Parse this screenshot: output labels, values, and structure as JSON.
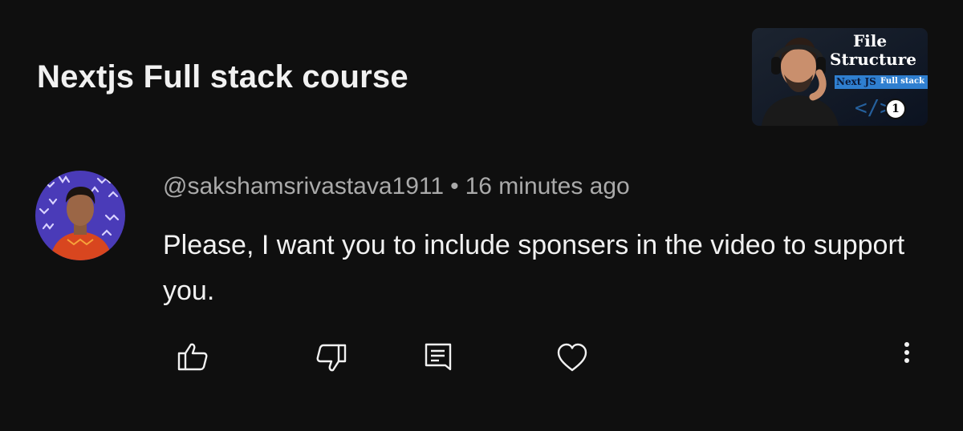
{
  "video": {
    "title": "Nextjs Full stack course",
    "thumbnail": {
      "line1": "File",
      "line2": "Structure",
      "banner_left": "Next JS",
      "banner_right": "Full stack",
      "episode": "1"
    }
  },
  "comment": {
    "author": "@sakshamsrivastava1911",
    "separator": "•",
    "time": "16 minutes ago",
    "text": "Please, I want you to include sponsers in the video to support you."
  },
  "actions": {
    "like_icon": "thumbs-up-icon",
    "dislike_icon": "thumbs-down-icon",
    "reply_icon": "reply-icon",
    "heart_icon": "heart-icon",
    "more_icon": "more-vertical-icon"
  },
  "colors": {
    "background": "#0f0f0f",
    "primary_text": "#f1f1f1",
    "secondary_text": "#aaaaaa",
    "thumbnail_banner": "#2f7fd0"
  }
}
